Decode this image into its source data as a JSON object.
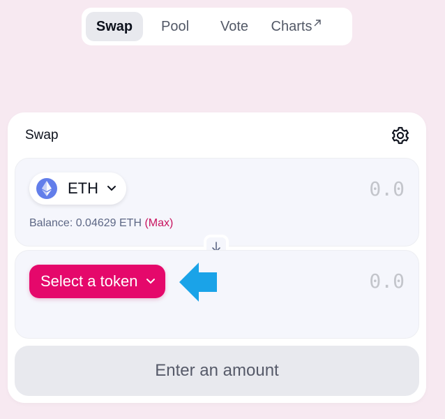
{
  "nav": {
    "items": [
      {
        "label": "Swap",
        "active": true
      },
      {
        "label": "Pool",
        "active": false
      },
      {
        "label": "Vote",
        "active": false
      },
      {
        "label": "Charts",
        "external_icon": "arrow-up-right-icon"
      }
    ]
  },
  "swap": {
    "title": "Swap",
    "settings_icon": "gear-icon",
    "input": {
      "token": "ETH",
      "token_icon": "ethereum-icon",
      "amount_placeholder": "0.0",
      "balance_label": "Balance: 0.04629 ETH",
      "max_label": "(Max)"
    },
    "switch_icon": "arrow-down-icon",
    "output": {
      "select_label": "Select a token",
      "amount_placeholder": "0.0"
    },
    "cta_label": "Enter an amount"
  },
  "colors": {
    "background": "#f7e9f1",
    "accent": "#e5086b",
    "annotation_arrow": "#1aa3e8"
  }
}
